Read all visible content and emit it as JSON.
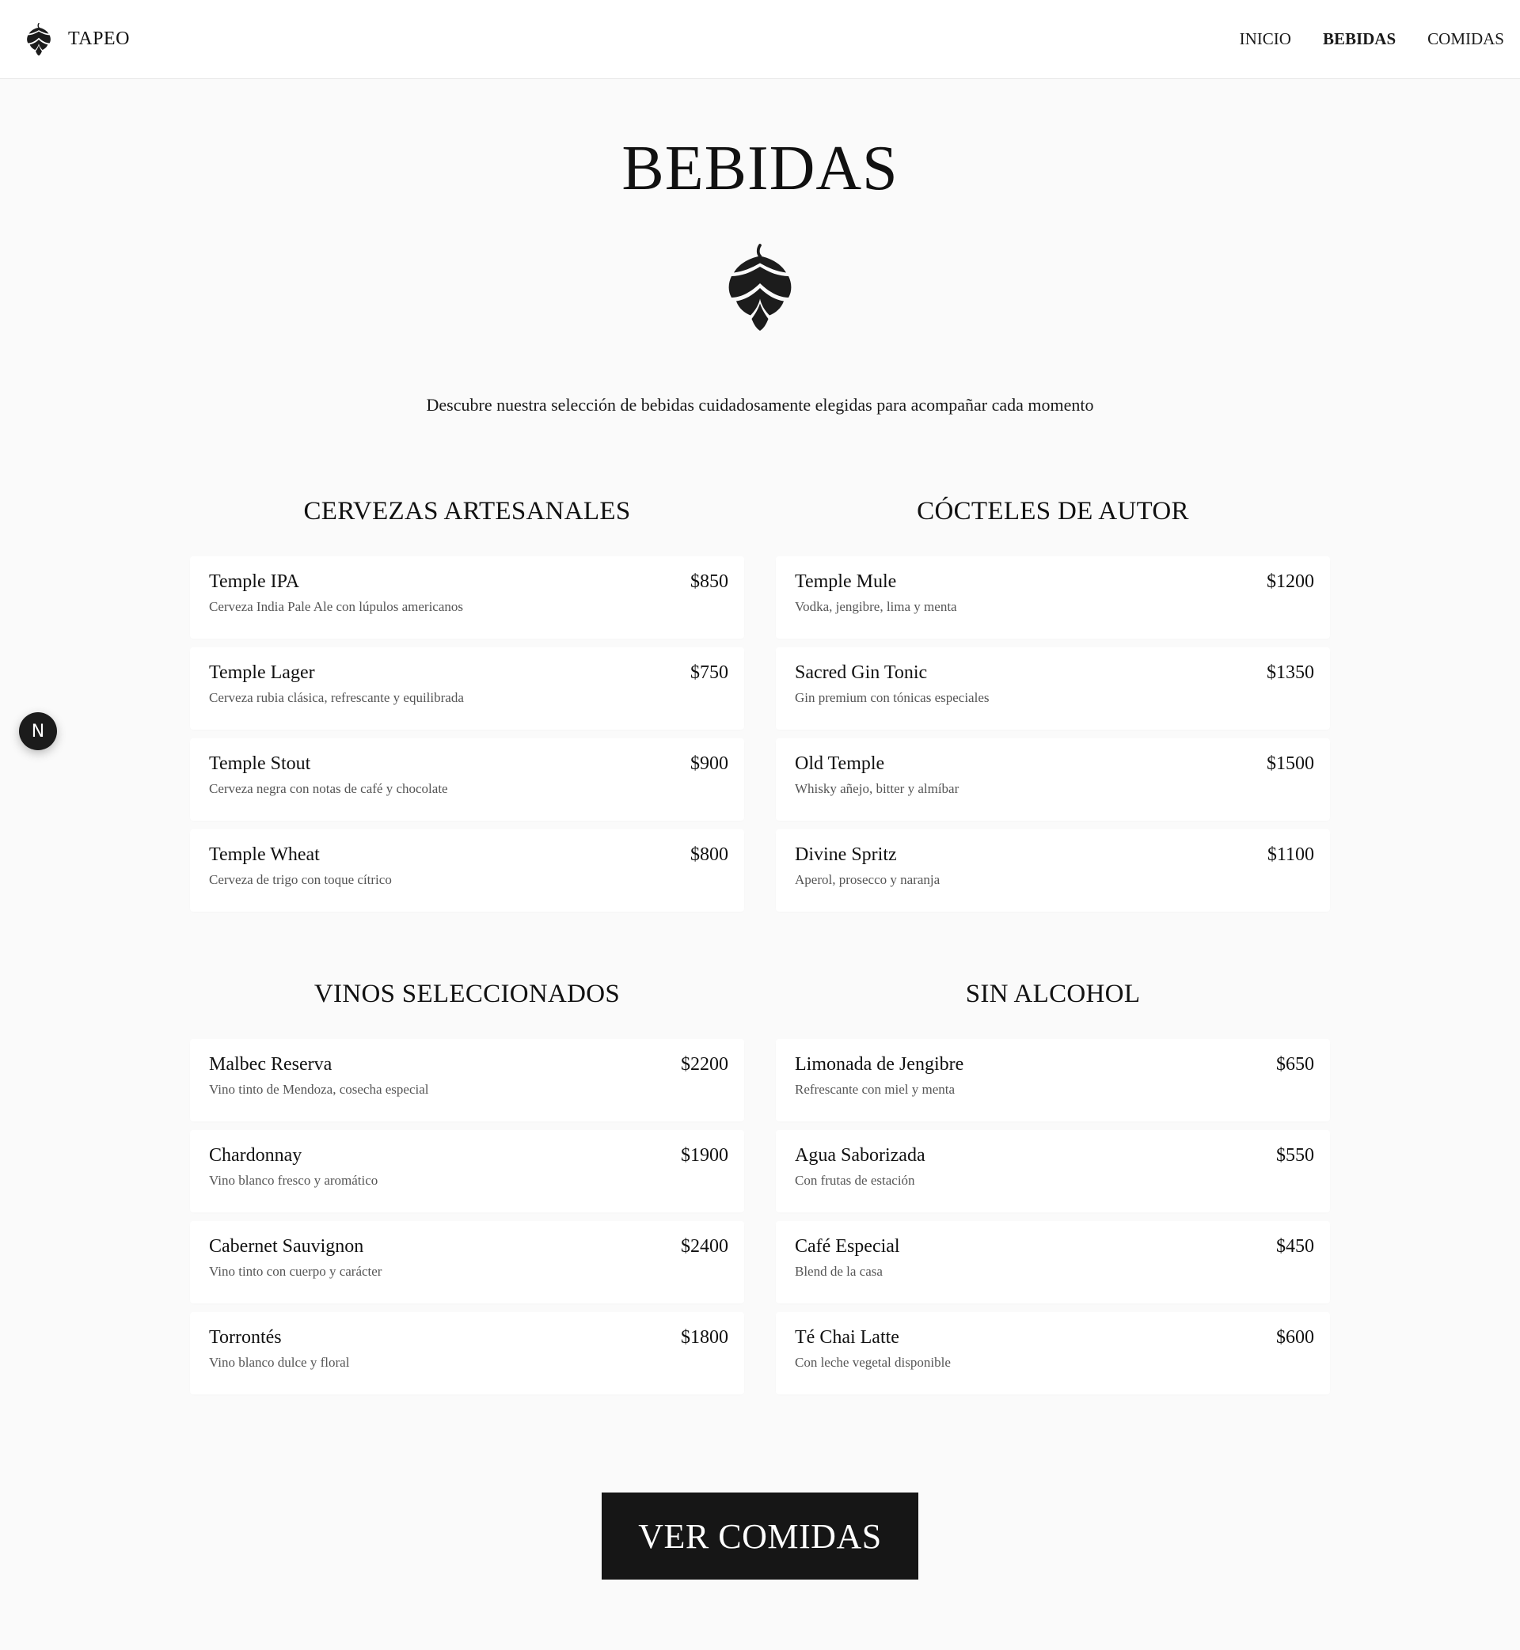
{
  "nav": {
    "brand": "TAPEO",
    "links": [
      {
        "label": "INICIO",
        "active": false
      },
      {
        "label": "BEBIDAS",
        "active": true
      },
      {
        "label": "COMIDAS",
        "active": false
      }
    ]
  },
  "page": {
    "title": "BEBIDAS",
    "intro": "Descubre nuestra selección de bebidas cuidadosamente elegidas para acompañar cada momento"
  },
  "sections": [
    {
      "title": "CERVEZAS ARTESANALES",
      "items": [
        {
          "name": "Temple IPA",
          "price": "$850",
          "desc": "Cerveza India Pale Ale con lúpulos americanos"
        },
        {
          "name": "Temple Lager",
          "price": "$750",
          "desc": "Cerveza rubia clásica, refrescante y equilibrada"
        },
        {
          "name": "Temple Stout",
          "price": "$900",
          "desc": "Cerveza negra con notas de café y chocolate"
        },
        {
          "name": "Temple Wheat",
          "price": "$800",
          "desc": "Cerveza de trigo con toque cítrico"
        }
      ]
    },
    {
      "title": "CÓCTELES DE AUTOR",
      "items": [
        {
          "name": "Temple Mule",
          "price": "$1200",
          "desc": "Vodka, jengibre, lima y menta"
        },
        {
          "name": "Sacred Gin Tonic",
          "price": "$1350",
          "desc": "Gin premium con tónicas especiales"
        },
        {
          "name": "Old Temple",
          "price": "$1500",
          "desc": "Whisky añejo, bitter y almíbar"
        },
        {
          "name": "Divine Spritz",
          "price": "$1100",
          "desc": "Aperol, prosecco y naranja"
        }
      ]
    },
    {
      "title": "VINOS SELECCIONADOS",
      "items": [
        {
          "name": "Malbec Reserva",
          "price": "$2200",
          "desc": "Vino tinto de Mendoza, cosecha especial"
        },
        {
          "name": "Chardonnay",
          "price": "$1900",
          "desc": "Vino blanco fresco y aromático"
        },
        {
          "name": "Cabernet Sauvignon",
          "price": "$2400",
          "desc": "Vino tinto con cuerpo y carácter"
        },
        {
          "name": "Torrontés",
          "price": "$1800",
          "desc": "Vino blanco dulce y floral"
        }
      ]
    },
    {
      "title": "SIN ALCOHOL",
      "items": [
        {
          "name": "Limonada de Jengibre",
          "price": "$650",
          "desc": "Refrescante con miel y menta"
        },
        {
          "name": "Agua Saborizada",
          "price": "$550",
          "desc": "Con frutas de estación"
        },
        {
          "name": "Café Especial",
          "price": "$450",
          "desc": "Blend de la casa"
        },
        {
          "name": "Té Chai Latte",
          "price": "$600",
          "desc": "Con leche vegetal disponible"
        }
      ]
    }
  ],
  "cta": {
    "label": "VER COMIDAS"
  },
  "dev_badge": {
    "label": "N"
  },
  "icons": {
    "brand": "hop-icon",
    "hero": "hop-icon"
  },
  "colors": {
    "background": "#fafafa",
    "card": "#ffffff",
    "text": "#111111",
    "muted": "#555555",
    "button": "#161616"
  }
}
